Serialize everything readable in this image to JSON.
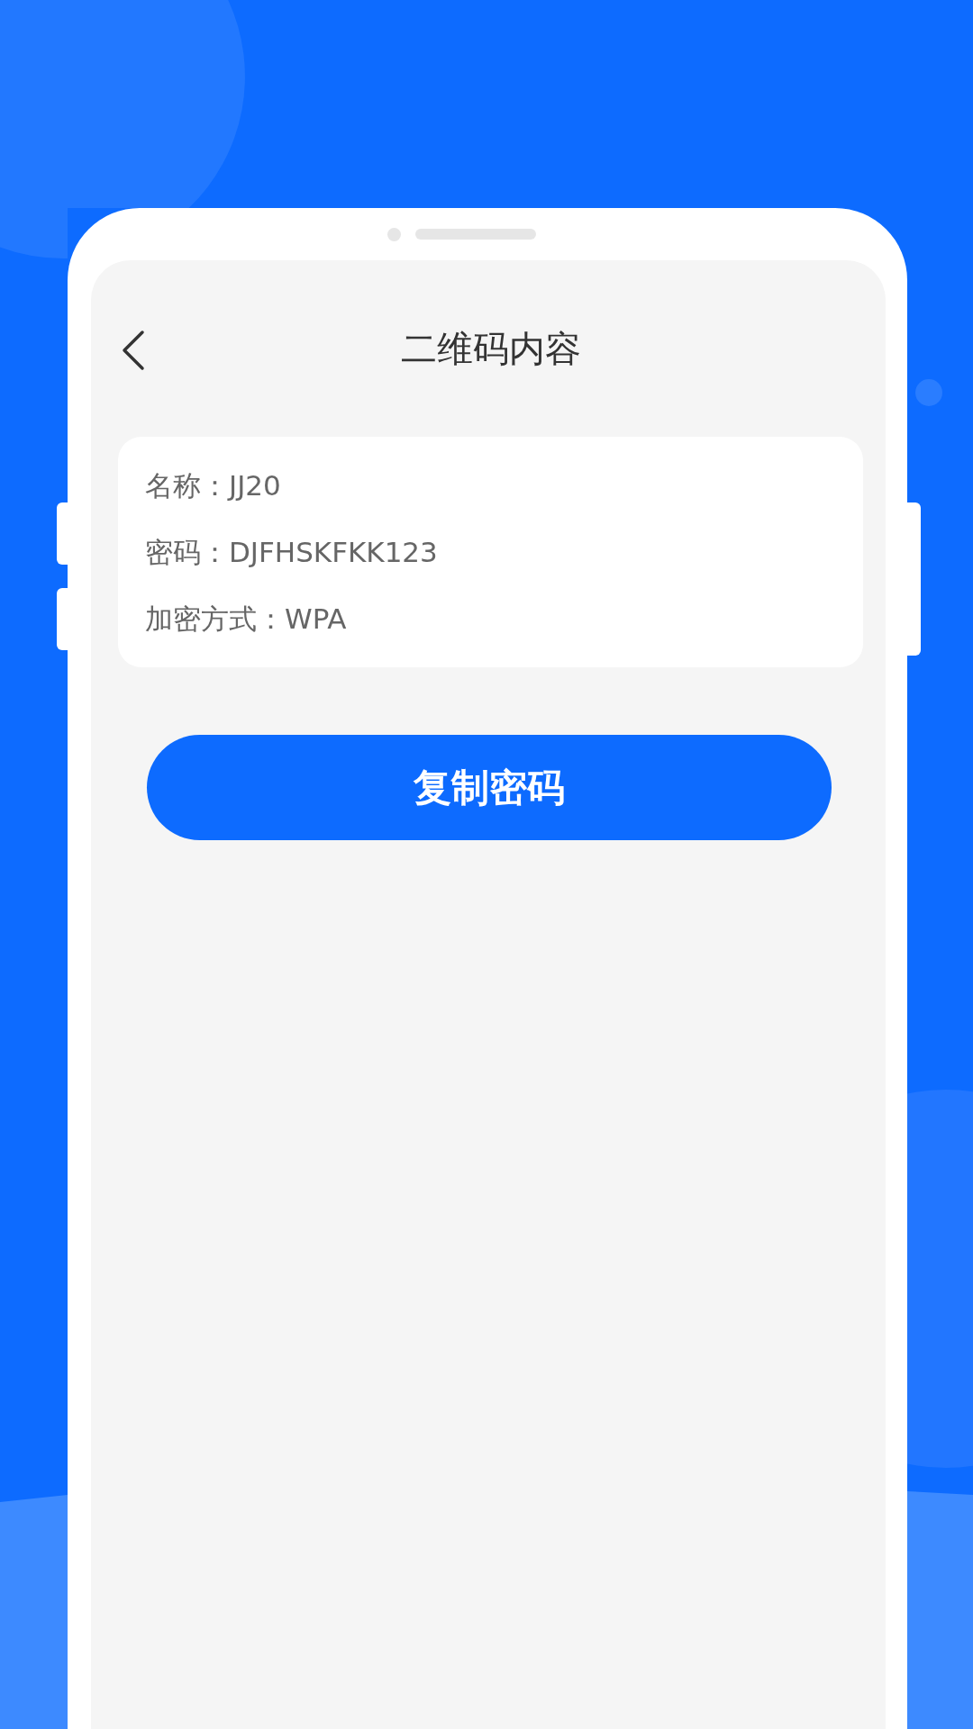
{
  "header": {
    "title": "二维码内容"
  },
  "details": [
    {
      "text": "名称：JJ20"
    },
    {
      "text": "密码：DJFHSKFKK123"
    },
    {
      "text": "加密方式：WPA"
    }
  ],
  "primary_button": {
    "label": "复制密码"
  }
}
